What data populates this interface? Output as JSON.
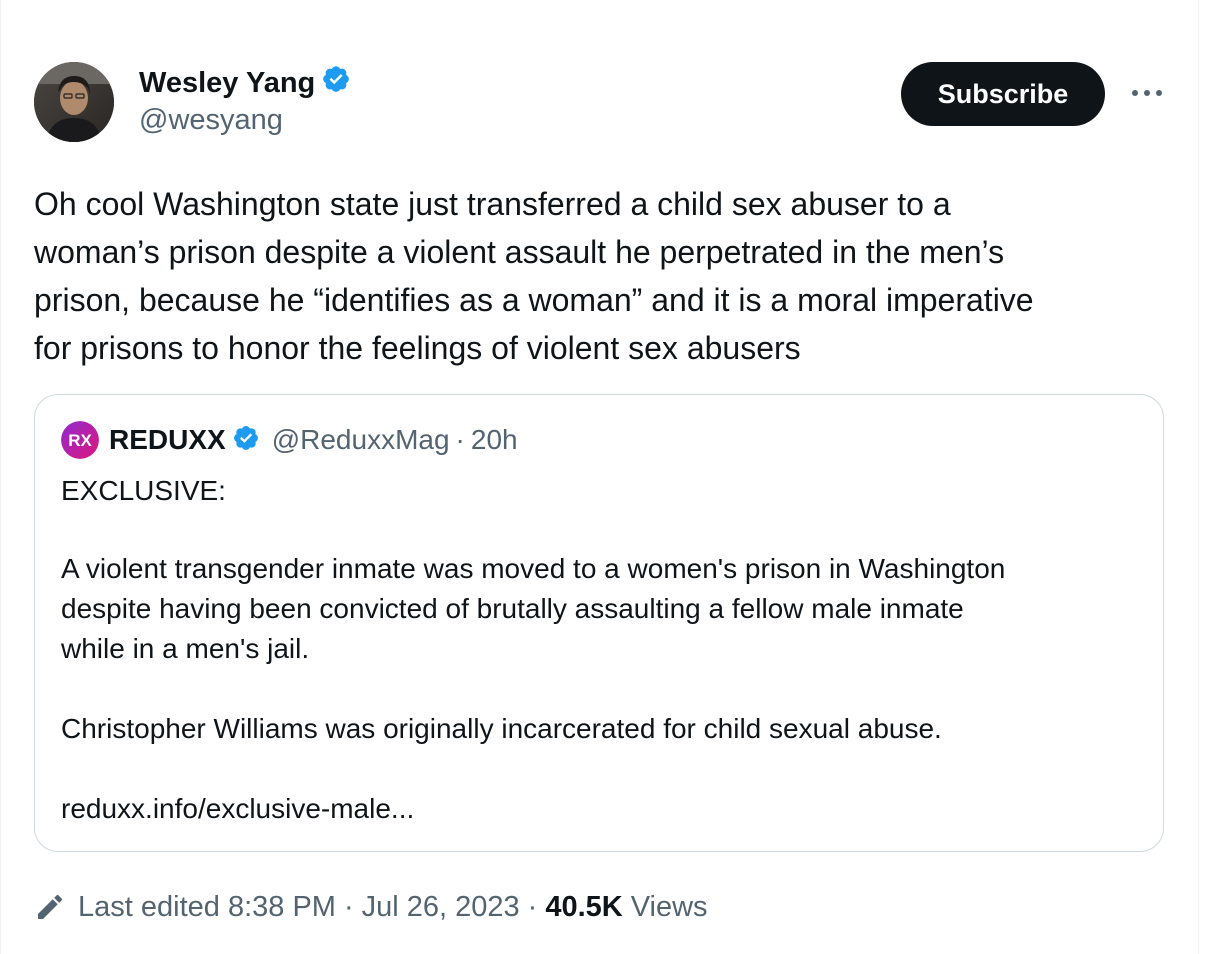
{
  "author": {
    "name": "Wesley Yang",
    "handle": "@wesyang",
    "verified_icon": "verified-badge-icon"
  },
  "actions": {
    "subscribe_label": "Subscribe",
    "more_icon": "more-options-icon"
  },
  "tweet": {
    "lines": [
      "Oh cool Washington state just transferred a child sex abuser to a",
      "woman’s prison despite a violent assault he perpetrated in the men’s",
      "prison, because he “identifies as a woman” and it is a moral imperative",
      "for prisons to honor the feelings of violent sex abusers"
    ]
  },
  "quote": {
    "logo_icon": "reduxx-logo-icon",
    "name": "REDUXX",
    "handle": "@ReduxxMag",
    "separator": "·",
    "time": "20h",
    "lines": [
      "EXCLUSIVE:",
      "A violent transgender inmate was moved to a women's prison in Washington",
      "despite having been convicted of brutally assaulting a fellow male inmate",
      "while in a men's jail.",
      "Christopher Williams was originally incarcerated for child sexual abuse.",
      "reduxx.info/exclusive-male..."
    ]
  },
  "footer": {
    "edit_icon": "pencil-icon",
    "edited_label": "Last edited 8:38 PM",
    "separator": "·",
    "date": "Jul 26, 2023",
    "views_count": "40.5K",
    "views_label": "Views"
  },
  "colors": {
    "text_primary": "#0f1419",
    "text_secondary": "#536471",
    "verified_blue": "#1d9bf0",
    "border": "#cfd9de",
    "button_bg": "#0f1419"
  }
}
